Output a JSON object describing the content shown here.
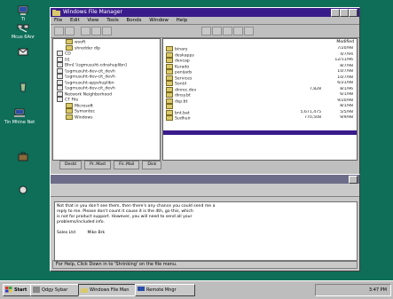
{
  "desktop": {
    "icons": [
      {
        "label": "Ti",
        "icon": "my-computer-icon"
      },
      {
        "label": "Mcus 6Anr",
        "icon": "network-icon"
      },
      {
        "label": "",
        "icon": "inbox-icon"
      },
      {
        "label": "",
        "icon": "recycle-bin-icon"
      },
      {
        "label": "Tin Mhine Net",
        "icon": "network-neighborhood-icon"
      },
      {
        "label": "",
        "icon": "briefcase-icon"
      },
      {
        "label": "",
        "icon": "shortcut-icon"
      }
    ]
  },
  "window": {
    "title": "Windows File Manager",
    "menu": [
      "File",
      "Edit",
      "View",
      "Tools",
      "Bonds",
      "Window",
      "Help"
    ],
    "left_pane": {
      "items": [
        {
          "label": "wsoft",
          "kind": "folder"
        },
        {
          "label": "shredder dlp",
          "kind": "folder"
        },
        {
          "label": "CD",
          "kind": "drive"
        },
        {
          "label": "[t]",
          "kind": "drive"
        },
        {
          "label": "Bhn[ \\\\sgmusuht-cdnahuplibn]",
          "kind": "drive"
        },
        {
          "label": "\\\\sgmusuht-dev-cit_devh",
          "kind": "drive"
        },
        {
          "label": "\\\\sgmusuht-dev-cit_devh",
          "kind": "drive"
        },
        {
          "label": "\\\\sgmusuht-appshuplibn",
          "kind": "drive"
        },
        {
          "label": "\\\\sgmusuht-dev-cit_devh",
          "kind": "drive"
        },
        {
          "label": "Network Neighborhood",
          "kind": "network"
        },
        {
          "label": "CT File",
          "kind": "drive"
        },
        {
          "label": "Microsoft",
          "kind": "folder"
        },
        {
          "label": "Symantec",
          "kind": "folder"
        },
        {
          "label": "Windows",
          "kind": "folder"
        }
      ]
    },
    "right_pane": {
      "header": "Modified",
      "items": [
        {
          "name": "binary",
          "size": "",
          "date": "7/20/98"
        },
        {
          "name": "deskapps",
          "size": "",
          "date": "4/7/94"
        },
        {
          "name": "devcap",
          "size": "",
          "date": "12/11/96"
        },
        {
          "name": "Kurado",
          "size": "",
          "date": "8/7/98"
        },
        {
          "name": "panijads",
          "size": "",
          "date": "10/7/98"
        },
        {
          "name": "Services",
          "size": "",
          "date": "10/7/98"
        },
        {
          "name": "Sontil",
          "size": "",
          "date": "6/21/98"
        },
        {
          "name": "dinrec.dev",
          "size": "7,828",
          "date": "8/1/96"
        },
        {
          "name": "dinsy.bt",
          "size": "",
          "date": "6/1/98"
        },
        {
          "name": "dsp.bt",
          "size": "",
          "date": "9/20/98"
        },
        {
          "name": "",
          "size": "",
          "date": "8/1/98"
        },
        {
          "name": "bnt.bat",
          "size": "5,671,475",
          "date": "5/5/98"
        },
        {
          "name": "Sudhuir",
          "size": "770,508",
          "date": "9/9/98"
        }
      ]
    },
    "status": "",
    "tabs": [
      "Deskt",
      "Pr..Mast",
      "Fir..Mail",
      "Disk"
    ]
  },
  "lower_window": {
    "body_lines": [
      "Not that in you don't see them, then there's any chance you could send me a",
      "reply to me. Please don't count it cause it is the 4th, go this, which",
      "is not for product support. However, you will need to send all your",
      "problems/included info."
    ],
    "signature": [
      "Sales Ltd",
      "Mike Brk"
    ],
    "footer": "For Help, Click Down in to 'Shrinking' on the file menu."
  },
  "taskbar": {
    "buttons": [
      {
        "label": "Start",
        "icon": "windows-logo-icon"
      },
      {
        "label": "Qdgy Sybar",
        "icon": "app-icon"
      },
      {
        "label": "Windows File Man",
        "icon": "folder-icon"
      },
      {
        "label": "Remote Mngr",
        "icon": "monitor-icon"
      }
    ],
    "tray_time": "3:47 PM"
  },
  "colors": {
    "desktop": "#0e6e58",
    "title_active": "#3a1b8c",
    "window_face": "#bfbfbf"
  }
}
